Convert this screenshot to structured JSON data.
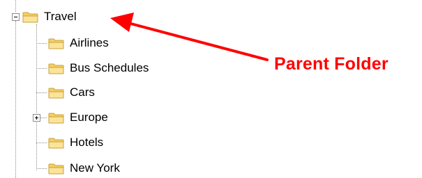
{
  "tree": {
    "root": {
      "label": "Travel",
      "expanded": true
    },
    "children": [
      {
        "label": "Airlines",
        "has_children": false
      },
      {
        "label": "Bus Schedules",
        "has_children": false
      },
      {
        "label": "Cars",
        "has_children": false
      },
      {
        "label": "Europe",
        "has_children": true,
        "expanded": false
      },
      {
        "label": "Hotels",
        "has_children": false
      },
      {
        "label": "New York",
        "has_children": false
      }
    ]
  },
  "annotation": {
    "text": "Parent Folder",
    "color": "#ff0000",
    "arrow_target": "Travel"
  },
  "icons": {
    "folder": "folder-icon",
    "expand": "plus-box-icon",
    "collapse": "minus-box-icon"
  },
  "colors": {
    "folder_fill": "#f9d978",
    "folder_stroke": "#c8a13a",
    "tree_lines": "#8c8c8c"
  }
}
